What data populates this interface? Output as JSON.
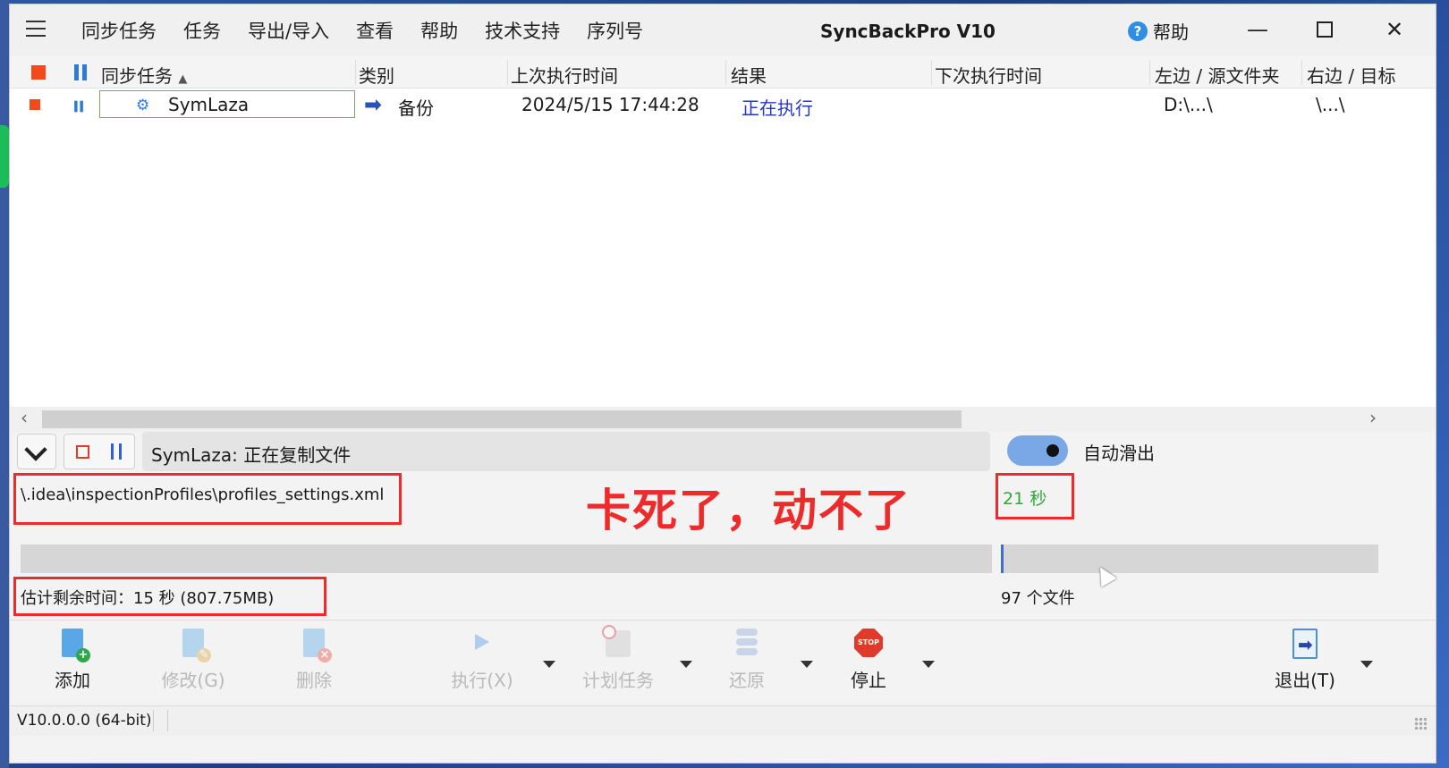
{
  "window": {
    "title": "SyncBackPro V10"
  },
  "menu": {
    "items": [
      "同步任务",
      "任务",
      "导出/导入",
      "查看",
      "帮助",
      "技术支持",
      "序列号"
    ],
    "help_label": "帮助"
  },
  "table": {
    "columns": [
      "同步任务",
      "类别",
      "上次执行时间",
      "结果",
      "下次执行时间",
      "左边 / 源文件夹",
      "右边 / 目标"
    ],
    "rows": [
      {
        "name": "SymLaza",
        "category": "备份",
        "last_run": "2024/5/15 17:44:28",
        "result": "正在执行",
        "next_run": "",
        "left": "D:\\...\\",
        "right": "\\...\\"
      }
    ]
  },
  "progress": {
    "status_text": "SymLaza: 正在复制文件",
    "auto_slide_label": "自动滑出",
    "auto_slide_on": true,
    "current_file": "\\.idea\\inspectionProfiles\\profiles_settings.xml",
    "annotation": "卡死了，动不了",
    "elapsed": "21 秒",
    "overall_fraction": 0.0,
    "file_fraction": 0.006,
    "eta_text": "估计剩余时间：15 秒 (807.75MB)",
    "files_text": "97 个文件"
  },
  "toolbar": {
    "add": "添加",
    "modify": "修改(G)",
    "delete": "删除",
    "run": "执行(X)",
    "schedule": "计划任务",
    "restore": "还原",
    "stop": "停止",
    "stop_icon_text": "STOP",
    "exit": "退出(T)"
  },
  "statusbar": {
    "version": "V10.0.0.0 (64-bit)"
  },
  "colors": {
    "accent": "#2f7ad8",
    "running_text": "#2638c8",
    "annotation_red": "#ee2a2a",
    "elapsed_green": "#2fa83a"
  }
}
